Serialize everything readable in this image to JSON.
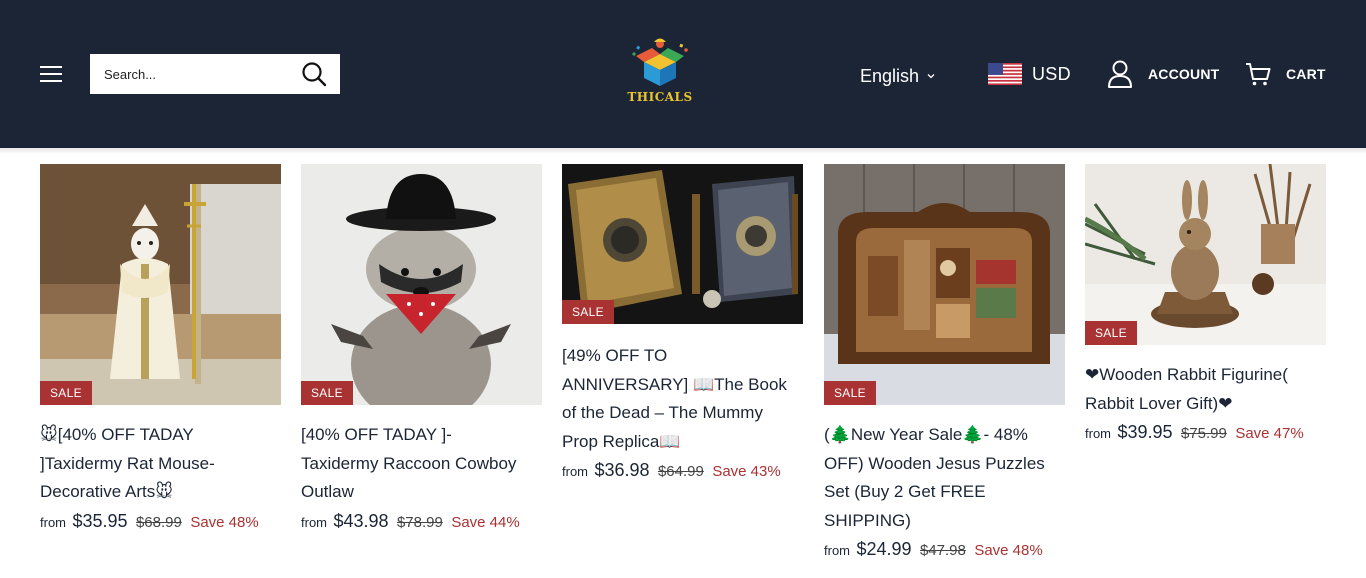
{
  "header": {
    "search_placeholder": "Search...",
    "logo_text": "THICALS",
    "language": "English",
    "currency": "USD",
    "account_label": "ACCOUNT",
    "cart_label": "CART"
  },
  "colors": {
    "header_bg": "#1b2535",
    "sale_badge": "#a93233",
    "save_text": "#a93233",
    "logo_gold": "#e9c42f"
  },
  "products": [
    {
      "badge": "SALE",
      "title": "🐭[40% OFF TADAY\n]Taxidermy Rat Mouse-\nDecorative Arts🐭",
      "from": "from",
      "price": "$35.95",
      "compare_price": "$68.99",
      "save": "Save 48%"
    },
    {
      "badge": "SALE",
      "title": "    [40% OFF TADAY ]-\nTaxidermy Raccoon Cowboy\nOutlaw",
      "from": "from",
      "price": "$43.98",
      "compare_price": "$78.99",
      "save": "Save 44%"
    },
    {
      "badge": "SALE",
      "title": "[49% OFF TO\nANNIVERSARY] 📖The Book\nof the Dead – The Mummy\nProp Replica📖",
      "from": "from",
      "price": "$36.98",
      "compare_price": "$64.99",
      "save": "Save 43%"
    },
    {
      "badge": "SALE",
      "title": "(🌲New Year Sale🌲- 48%\nOFF) Wooden Jesus Puzzles\nSet (Buy 2 Get FREE\nSHIPPING)",
      "from": "from",
      "price": "$24.99",
      "compare_price": "$47.98",
      "save": "Save 48%"
    },
    {
      "badge": "SALE",
      "title": "❤Wooden Rabbit Figurine(\nRabbit Lover Gift)❤",
      "from": "from",
      "price": "$39.95",
      "compare_price": "$75.99",
      "save": "Save 47%"
    }
  ]
}
